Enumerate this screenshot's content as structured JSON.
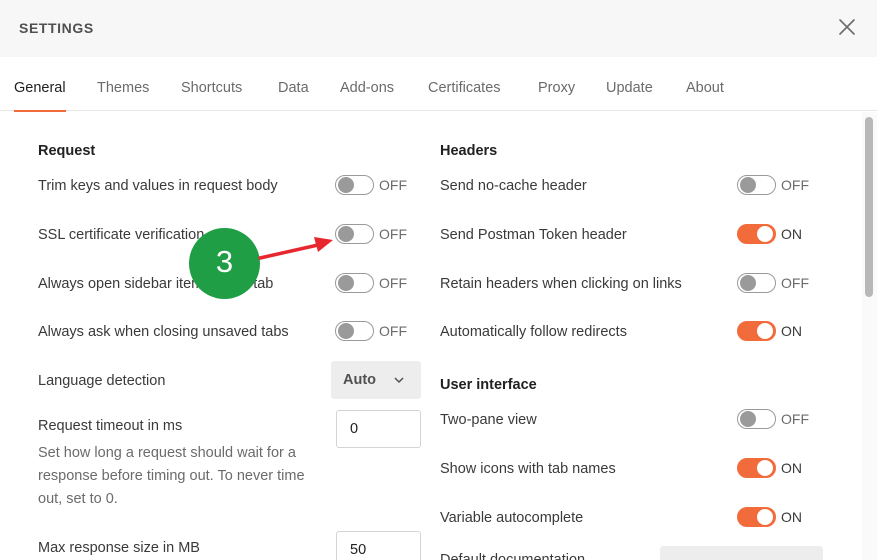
{
  "header": {
    "title": "SETTINGS"
  },
  "tabs": [
    "General",
    "Themes",
    "Shortcuts",
    "Data",
    "Add-ons",
    "Certificates",
    "Proxy",
    "Update",
    "About"
  ],
  "request": {
    "title": "Request",
    "trim_label": "Trim keys and values in request body",
    "trim_state": "OFF",
    "ssl_label": "SSL certificate verification",
    "ssl_state": "OFF",
    "sidebar_label": "Always open sidebar item in new tab",
    "sidebar_state": "OFF",
    "ask_label": "Always ask when closing unsaved tabs",
    "ask_state": "OFF",
    "lang_label": "Language detection",
    "lang_value": "Auto",
    "timeout_label": "Request timeout in ms",
    "timeout_help": "Set how long a request should wait for a response before timing out. To never time out, set to 0.",
    "timeout_value": "0",
    "maxsize_label": "Max response size in MB",
    "maxsize_value": "50"
  },
  "headers": {
    "title": "Headers",
    "nocache_label": "Send no-cache header",
    "nocache_state": "OFF",
    "token_label": "Send Postman Token header",
    "token_state": "ON",
    "retain_label": "Retain headers when clicking on links",
    "retain_state": "OFF",
    "follow_label": "Automatically follow redirects",
    "follow_state": "ON"
  },
  "ui": {
    "title": "User interface",
    "twopane_label": "Two-pane view",
    "twopane_state": "OFF",
    "icons_label": "Show icons with tab names",
    "icons_state": "ON",
    "autocomplete_label": "Variable autocomplete",
    "autocomplete_state": "ON",
    "docs_label": "Default documentation"
  },
  "annotation": {
    "badge": "3"
  },
  "colors": {
    "accent": "#f26b3a",
    "badge": "#1f9e45",
    "arrow": "#e8262e"
  },
  "icons": {
    "close": "close-icon",
    "chevron": "chevron-down-icon"
  }
}
